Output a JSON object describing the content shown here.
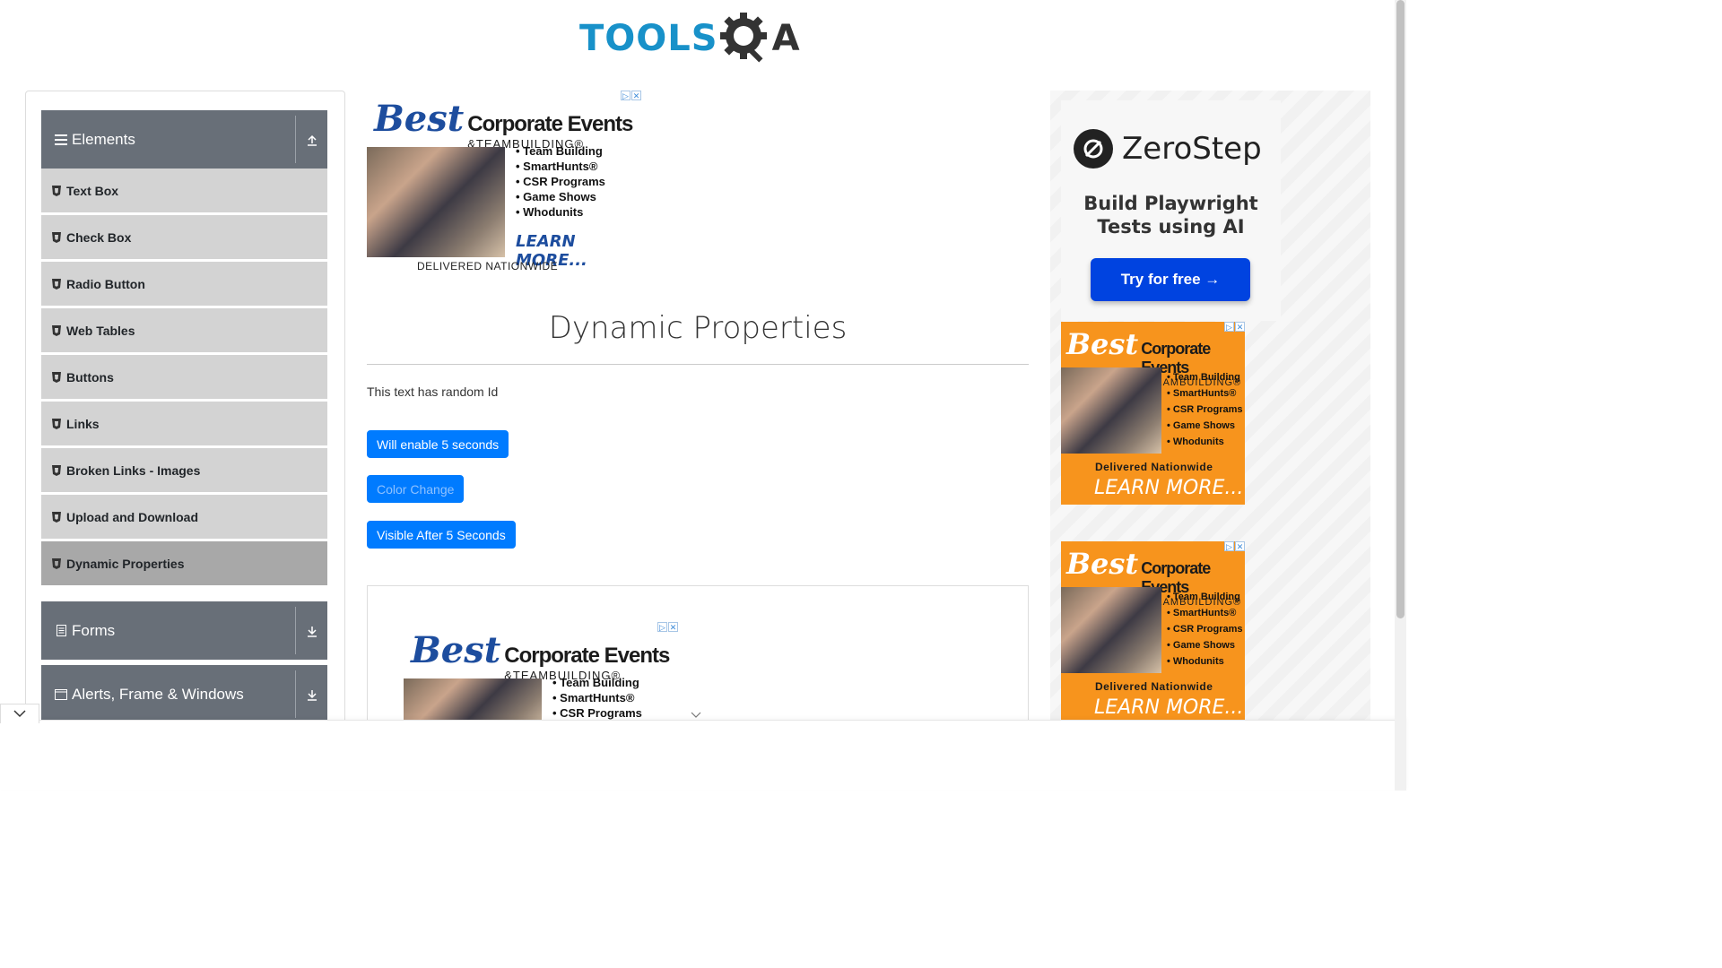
{
  "header": {
    "logo_tools": "TOOLS",
    "logo_qa": "A"
  },
  "sidebar": {
    "groups": [
      {
        "label": "Elements",
        "icon": "hamburger-icon",
        "toggle": "collapse-up-icon"
      },
      {
        "label": "Forms",
        "icon": "document-icon",
        "toggle": "expand-down-icon"
      },
      {
        "label": "Alerts, Frame & Windows",
        "icon": "window-icon",
        "toggle": "expand-down-icon"
      }
    ],
    "items": [
      {
        "label": "Text Box"
      },
      {
        "label": "Check Box"
      },
      {
        "label": "Radio Button"
      },
      {
        "label": "Web Tables"
      },
      {
        "label": "Buttons"
      },
      {
        "label": "Links"
      },
      {
        "label": "Broken Links - Images"
      },
      {
        "label": "Upload and Download"
      },
      {
        "label": "Dynamic Properties"
      }
    ],
    "active_item": "Dynamic Properties"
  },
  "main": {
    "title": "Dynamic Properties",
    "random_text": "This text has random Id",
    "buttons": {
      "enable": "Will enable 5 seconds",
      "color_change": "Color Change",
      "visible": "Visible After 5 Seconds"
    }
  },
  "ads": {
    "best": "Best",
    "corporate": "Corporate Events",
    "team": "&TEAMBUILDING®",
    "list": [
      "• Team Building",
      "• SmartHunts®",
      "• CSR Programs",
      "• Game Shows",
      "• Whodunits"
    ],
    "list_short": [
      "• Team Building",
      "• SmartHunts®",
      "• CSR Programs"
    ],
    "learn_more": "LEARN MORE...",
    "delivered_upper": "DELIVERED NATIONWIDE",
    "delivered": "Delivered Nationwide",
    "zerostep_name": "ZeroStep",
    "zerostep_tag": "Build Playwright Tests using AI",
    "zerostep_button": "Try for free →"
  },
  "colors": {
    "primary": "#007bff",
    "sidebar_header": "#686f78",
    "sidebar_item": "#d3d3d3",
    "sidebar_active": "#a8a8a8",
    "ad_orange": "#f7941d",
    "zerostep_blue": "#0043e0",
    "logo_blue": "#1891c9"
  }
}
